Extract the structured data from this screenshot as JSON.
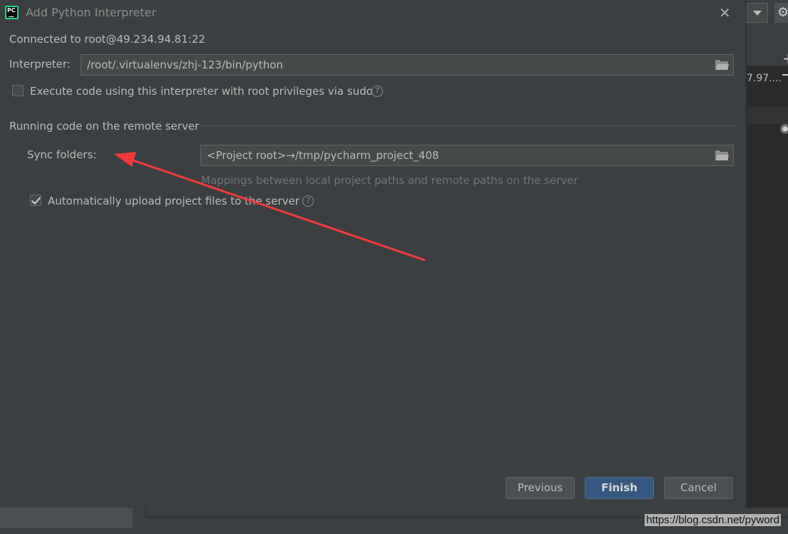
{
  "dialog": {
    "title": "Add Python Interpreter",
    "connection": "Connected to root@49.234.94.81:22",
    "interpreter_label": "Interpreter:",
    "interpreter_value": "/root/.virtualenvs/zhj-123/bin/python",
    "sudo_label": "Execute code using this interpreter with root privileges via sudo",
    "sudo_checked": false,
    "section_title": "Running code on the remote server",
    "sync_label": "Sync folders:",
    "sync_value": "<Project root>→/tmp/pycharm_project_408",
    "sync_hint": "Mappings between local project paths and remote paths on the server",
    "upload_label": "Automatically upload project files to the server",
    "upload_checked": true
  },
  "buttons": {
    "previous": "Previous",
    "finish": "Finish",
    "cancel": "Cancel"
  },
  "background": {
    "right_text": "7.97...."
  },
  "watermark": "https://blog.csdn.net/pyword",
  "colors": {
    "annotation_arrow": "#f03a3a",
    "primary_button": "#365880",
    "dialog_bg": "#3c3f41"
  },
  "icons": {
    "close": "close-icon",
    "folder": "folder-icon",
    "help": "help-icon",
    "app": "pycharm-icon"
  }
}
